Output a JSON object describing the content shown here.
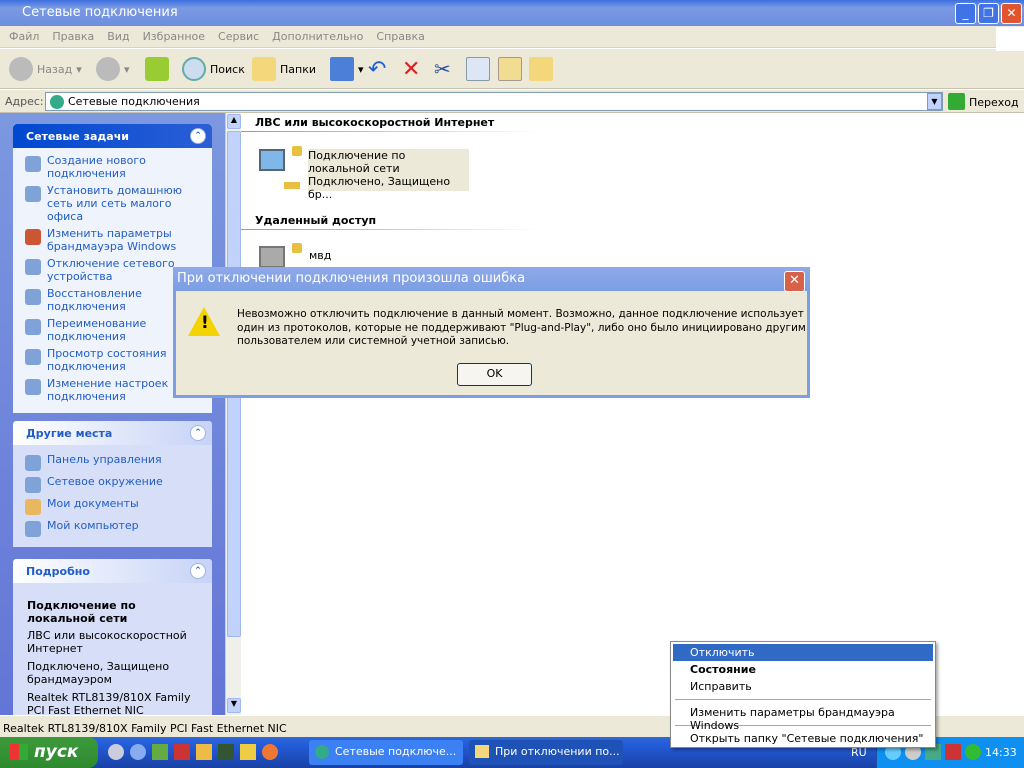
{
  "window": {
    "title": "Сетевые подключения"
  },
  "menu": [
    "Файл",
    "Правка",
    "Вид",
    "Избранное",
    "Сервис",
    "Дополнительно",
    "Справка"
  ],
  "toolbar": {
    "back": "Назад",
    "search": "Поиск",
    "folders": "Папки"
  },
  "address": {
    "label": "Адрес:",
    "value": "Сетевые подключения",
    "go": "Переход"
  },
  "panels": {
    "tasks": {
      "title": "Сетевые задачи",
      "items": [
        "Создание нового подключения",
        "Установить домашнюю сеть или сеть малого офиса",
        "Изменить параметры брандмауэра Windows",
        "Отключение сетевого устройства",
        "Восстановление подключения",
        "Переименование подключения",
        "Просмотр состояния подключения",
        "Изменение настроек подключения"
      ]
    },
    "places": {
      "title": "Другие места",
      "items": [
        "Панель управления",
        "Сетевое окружение",
        "Мои документы",
        "Мой компьютер"
      ]
    },
    "details": {
      "title": "Подробно",
      "name": "Подключение по локальной сети",
      "type": "ЛВС или высокоскоростной Интернет",
      "status": "Подключено, Защищено брандмауэром",
      "device": "Realtek RTL8139/810X Family PCI Fast Ethernet NIC"
    }
  },
  "groups": [
    {
      "title": "ЛВС или высокоскоростной Интернет",
      "items": [
        {
          "name": "Подключение по локальной сети",
          "status": "Подключено, Защищено бр..."
        }
      ]
    },
    {
      "title": "Удаленный доступ",
      "items": [
        {
          "name": "мвд"
        }
      ]
    }
  ],
  "dialog": {
    "title": "При отключении подключения произошла ошибка",
    "message": "Невозможно отключить подключение в данный момент. Возможно, данное подключение использует один из протоколов, которые не поддерживают \"Plug-and-Play\", либо оно было инициировано другим пользователем или системной учетной записью.",
    "ok": "OK"
  },
  "context_menu": [
    "Отключить",
    "Состояние",
    "Исправить",
    "Изменить параметры брандмауэра Windows",
    "Открыть папку \"Сетевые подключения\""
  ],
  "status_bar": "Realtek RTL8139/810X Family PCI Fast Ethernet NIC",
  "taskbar": {
    "start": "пуск",
    "buttons": [
      "Сетевые подключе...",
      "При отключении по..."
    ],
    "lang": "RU",
    "clock": "14:33"
  }
}
